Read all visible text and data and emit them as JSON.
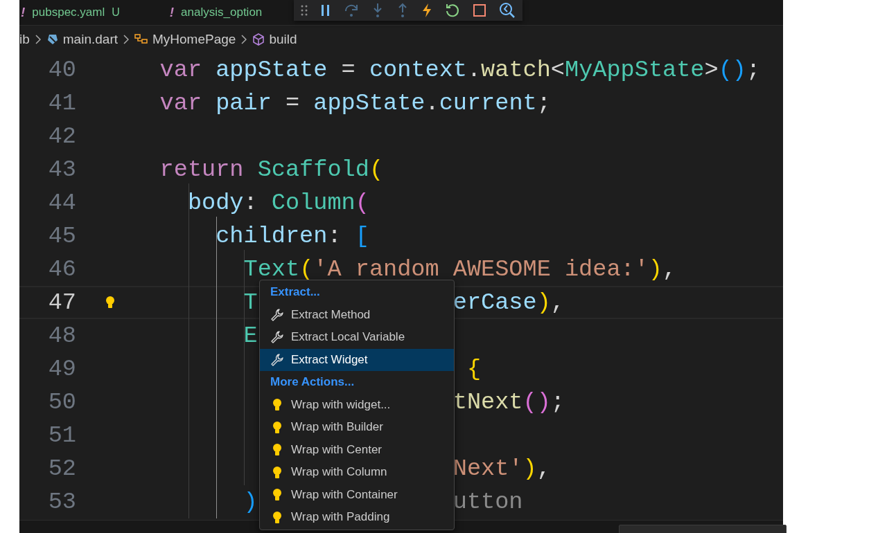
{
  "tabs": [
    {
      "marker": "!",
      "label": "pubspec.yaml",
      "badge": "U"
    },
    {
      "marker": "!",
      "label": "analysis_option"
    }
  ],
  "debug_toolbar": {
    "buttons": [
      {
        "kind": "pause",
        "disabled": false
      },
      {
        "kind": "step-over",
        "disabled": true
      },
      {
        "kind": "step-into",
        "disabled": true
      },
      {
        "kind": "step-out",
        "disabled": true
      },
      {
        "kind": "hot-reload",
        "disabled": false
      },
      {
        "kind": "restart",
        "disabled": false
      },
      {
        "kind": "stop",
        "disabled": false
      },
      {
        "kind": "inspector",
        "disabled": false
      }
    ]
  },
  "breadcrumbs": [
    {
      "kind": "folder",
      "label": "ib"
    },
    {
      "kind": "file",
      "label": "main.dart"
    },
    {
      "kind": "class",
      "label": "MyHomePage"
    },
    {
      "kind": "method",
      "label": "build"
    }
  ],
  "editor": {
    "lines": [
      {
        "number": "40",
        "current": false,
        "left": [
          {
            "t": "    var",
            "kind": "kw"
          },
          {
            "t": " appState ",
            "kind": "id"
          },
          {
            "t": "=",
            "kind": "p"
          },
          {
            "t": " context",
            "kind": "id"
          },
          {
            "t": ".",
            "kind": "p"
          },
          {
            "t": "watch",
            "kind": "fn"
          },
          {
            "t": "<",
            "kind": "p"
          },
          {
            "t": "MyAppState",
            "kind": "cls"
          },
          {
            "t": ">",
            "kind": "p"
          },
          {
            "t": "()",
            "kind": "b3"
          },
          {
            "t": ";",
            "kind": "p"
          }
        ]
      },
      {
        "number": "41",
        "current": false,
        "left": [
          {
            "t": "    var",
            "kind": "kw"
          },
          {
            "t": " pair ",
            "kind": "id"
          },
          {
            "t": "=",
            "kind": "p"
          },
          {
            "t": " appState",
            "kind": "id"
          },
          {
            "t": ".",
            "kind": "p"
          },
          {
            "t": "current",
            "kind": "id"
          },
          {
            "t": ";",
            "kind": "p"
          }
        ]
      },
      {
        "number": "42",
        "current": false
      },
      {
        "number": "43",
        "current": false,
        "left": [
          {
            "t": "    return",
            "kind": "kw"
          },
          {
            "t": " Scaffold",
            "kind": "cls"
          },
          {
            "t": "(",
            "kind": "b1"
          }
        ]
      },
      {
        "number": "44",
        "current": false,
        "left": [
          {
            "t": "      body",
            "kind": "id"
          },
          {
            "t": ": ",
            "kind": "p"
          },
          {
            "t": "Column",
            "kind": "cls"
          },
          {
            "t": "(",
            "kind": "b2"
          }
        ]
      },
      {
        "number": "45",
        "current": false,
        "left": [
          {
            "t": "        children",
            "kind": "id"
          },
          {
            "t": ": ",
            "kind": "p"
          },
          {
            "t": "[",
            "kind": "b3"
          }
        ]
      },
      {
        "number": "46",
        "current": false,
        "left": [
          {
            "t": "          Text",
            "kind": "cls"
          },
          {
            "t": "(",
            "kind": "b1"
          },
          {
            "t": "'A random",
            "kind": "str"
          }
        ],
        "right": [
          {
            "t": "AWESOME idea:'",
            "kind": "str"
          },
          {
            "t": ")",
            "kind": "b1"
          },
          {
            "t": ",",
            "kind": "p"
          }
        ]
      },
      {
        "number": "47",
        "current": true,
        "left": [
          {
            "t": "          T",
            "kind": "cls"
          }
        ],
        "right": [
          {
            "t": "erCase",
            "kind": "id"
          },
          {
            "t": ")",
            "kind": "b1"
          },
          {
            "t": ",",
            "kind": "p"
          }
        ]
      },
      {
        "number": "48",
        "current": false,
        "left": [
          {
            "t": "          E",
            "kind": "cls"
          }
        ]
      },
      {
        "number": "49",
        "current": false,
        "right": [
          {
            "t": " {",
            "kind": "b1"
          }
        ]
      },
      {
        "number": "50",
        "current": false,
        "right": [
          {
            "t": "tNext",
            "kind": "fn"
          },
          {
            "t": "()",
            "kind": "b2"
          },
          {
            "t": ";",
            "kind": "p"
          }
        ]
      },
      {
        "number": "51",
        "current": false
      },
      {
        "number": "52",
        "current": false,
        "right": [
          {
            "t": "Next'",
            "kind": "str"
          },
          {
            "t": ")",
            "kind": "b1"
          },
          {
            "t": ",",
            "kind": "p"
          }
        ]
      },
      {
        "number": "53",
        "current": false,
        "left": [
          {
            "t": "          )",
            "kind": "b3"
          }
        ],
        "right": [
          {
            "t": "utton",
            "kind": "cm"
          }
        ]
      }
    ]
  },
  "code_actions": {
    "groups": [
      {
        "heading": "Extract...",
        "items": [
          {
            "kind": "refactor",
            "label": "Extract Method",
            "selected": false
          },
          {
            "kind": "refactor",
            "label": "Extract Local Variable",
            "selected": false
          },
          {
            "kind": "refactor",
            "label": "Extract Widget",
            "selected": true
          }
        ]
      },
      {
        "heading": "More Actions...",
        "items": [
          {
            "kind": "quickfix",
            "label": "Wrap with widget...",
            "selected": false
          },
          {
            "kind": "quickfix",
            "label": "Wrap with Builder",
            "selected": false
          },
          {
            "kind": "quickfix",
            "label": "Wrap with Center",
            "selected": false
          },
          {
            "kind": "quickfix",
            "label": "Wrap with Column",
            "selected": false
          },
          {
            "kind": "quickfix",
            "label": "Wrap with Container",
            "selected": false
          },
          {
            "kind": "quickfix",
            "label": "Wrap with Padding",
            "selected": false
          }
        ]
      }
    ]
  }
}
